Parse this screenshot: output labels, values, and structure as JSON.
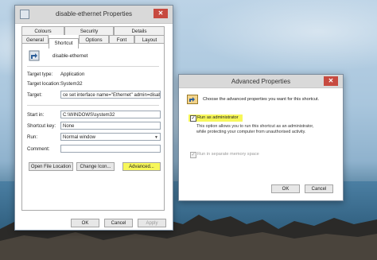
{
  "main_window": {
    "title": "disable-ethernet Properties",
    "close": "✕",
    "tabs_top": [
      "Colours",
      "Security",
      "Details"
    ],
    "tabs_bottom": [
      "General",
      "Shortcut",
      "Options",
      "Font",
      "Layout"
    ],
    "active_tab": "Shortcut",
    "shortcut_name": "disable-ethernet",
    "fields": {
      "target_type_label": "Target type:",
      "target_type_value": "Application",
      "target_location_label": "Target location:",
      "target_location_value": "System32",
      "target_label": "Target:",
      "target_value": "ce set interface name=\"Ethernet\" admin=disabled",
      "start_in_label": "Start in:",
      "start_in_value": "C:\\WINDOWS\\system32",
      "shortcut_key_label": "Shortcut key:",
      "shortcut_key_value": "None",
      "run_label": "Run:",
      "run_value": "Normal window",
      "comment_label": "Comment:",
      "comment_value": ""
    },
    "buttons": {
      "open_file_location": "Open File Location",
      "change_icon": "Change Icon...",
      "advanced": "Advanced...",
      "ok": "OK",
      "cancel": "Cancel",
      "apply": "Apply"
    }
  },
  "advanced_window": {
    "title": "Advanced Properties",
    "close": "✕",
    "description": "Choose the advanced properties you want for this shortcut.",
    "run_as_admin_label": "Run as administrator",
    "run_as_admin_checked": true,
    "info_text": "This option allows you to run this shortcut as an administrator, while protecting your computer from unauthorised activity.",
    "separate_memory_label": "Run in separate memory space",
    "separate_memory_checked": true,
    "buttons": {
      "ok": "OK",
      "cancel": "Cancel"
    }
  },
  "colors": {
    "highlight": "#f7f75a",
    "close_red": "#c74a40",
    "titlebar": "#d9d9d9"
  }
}
